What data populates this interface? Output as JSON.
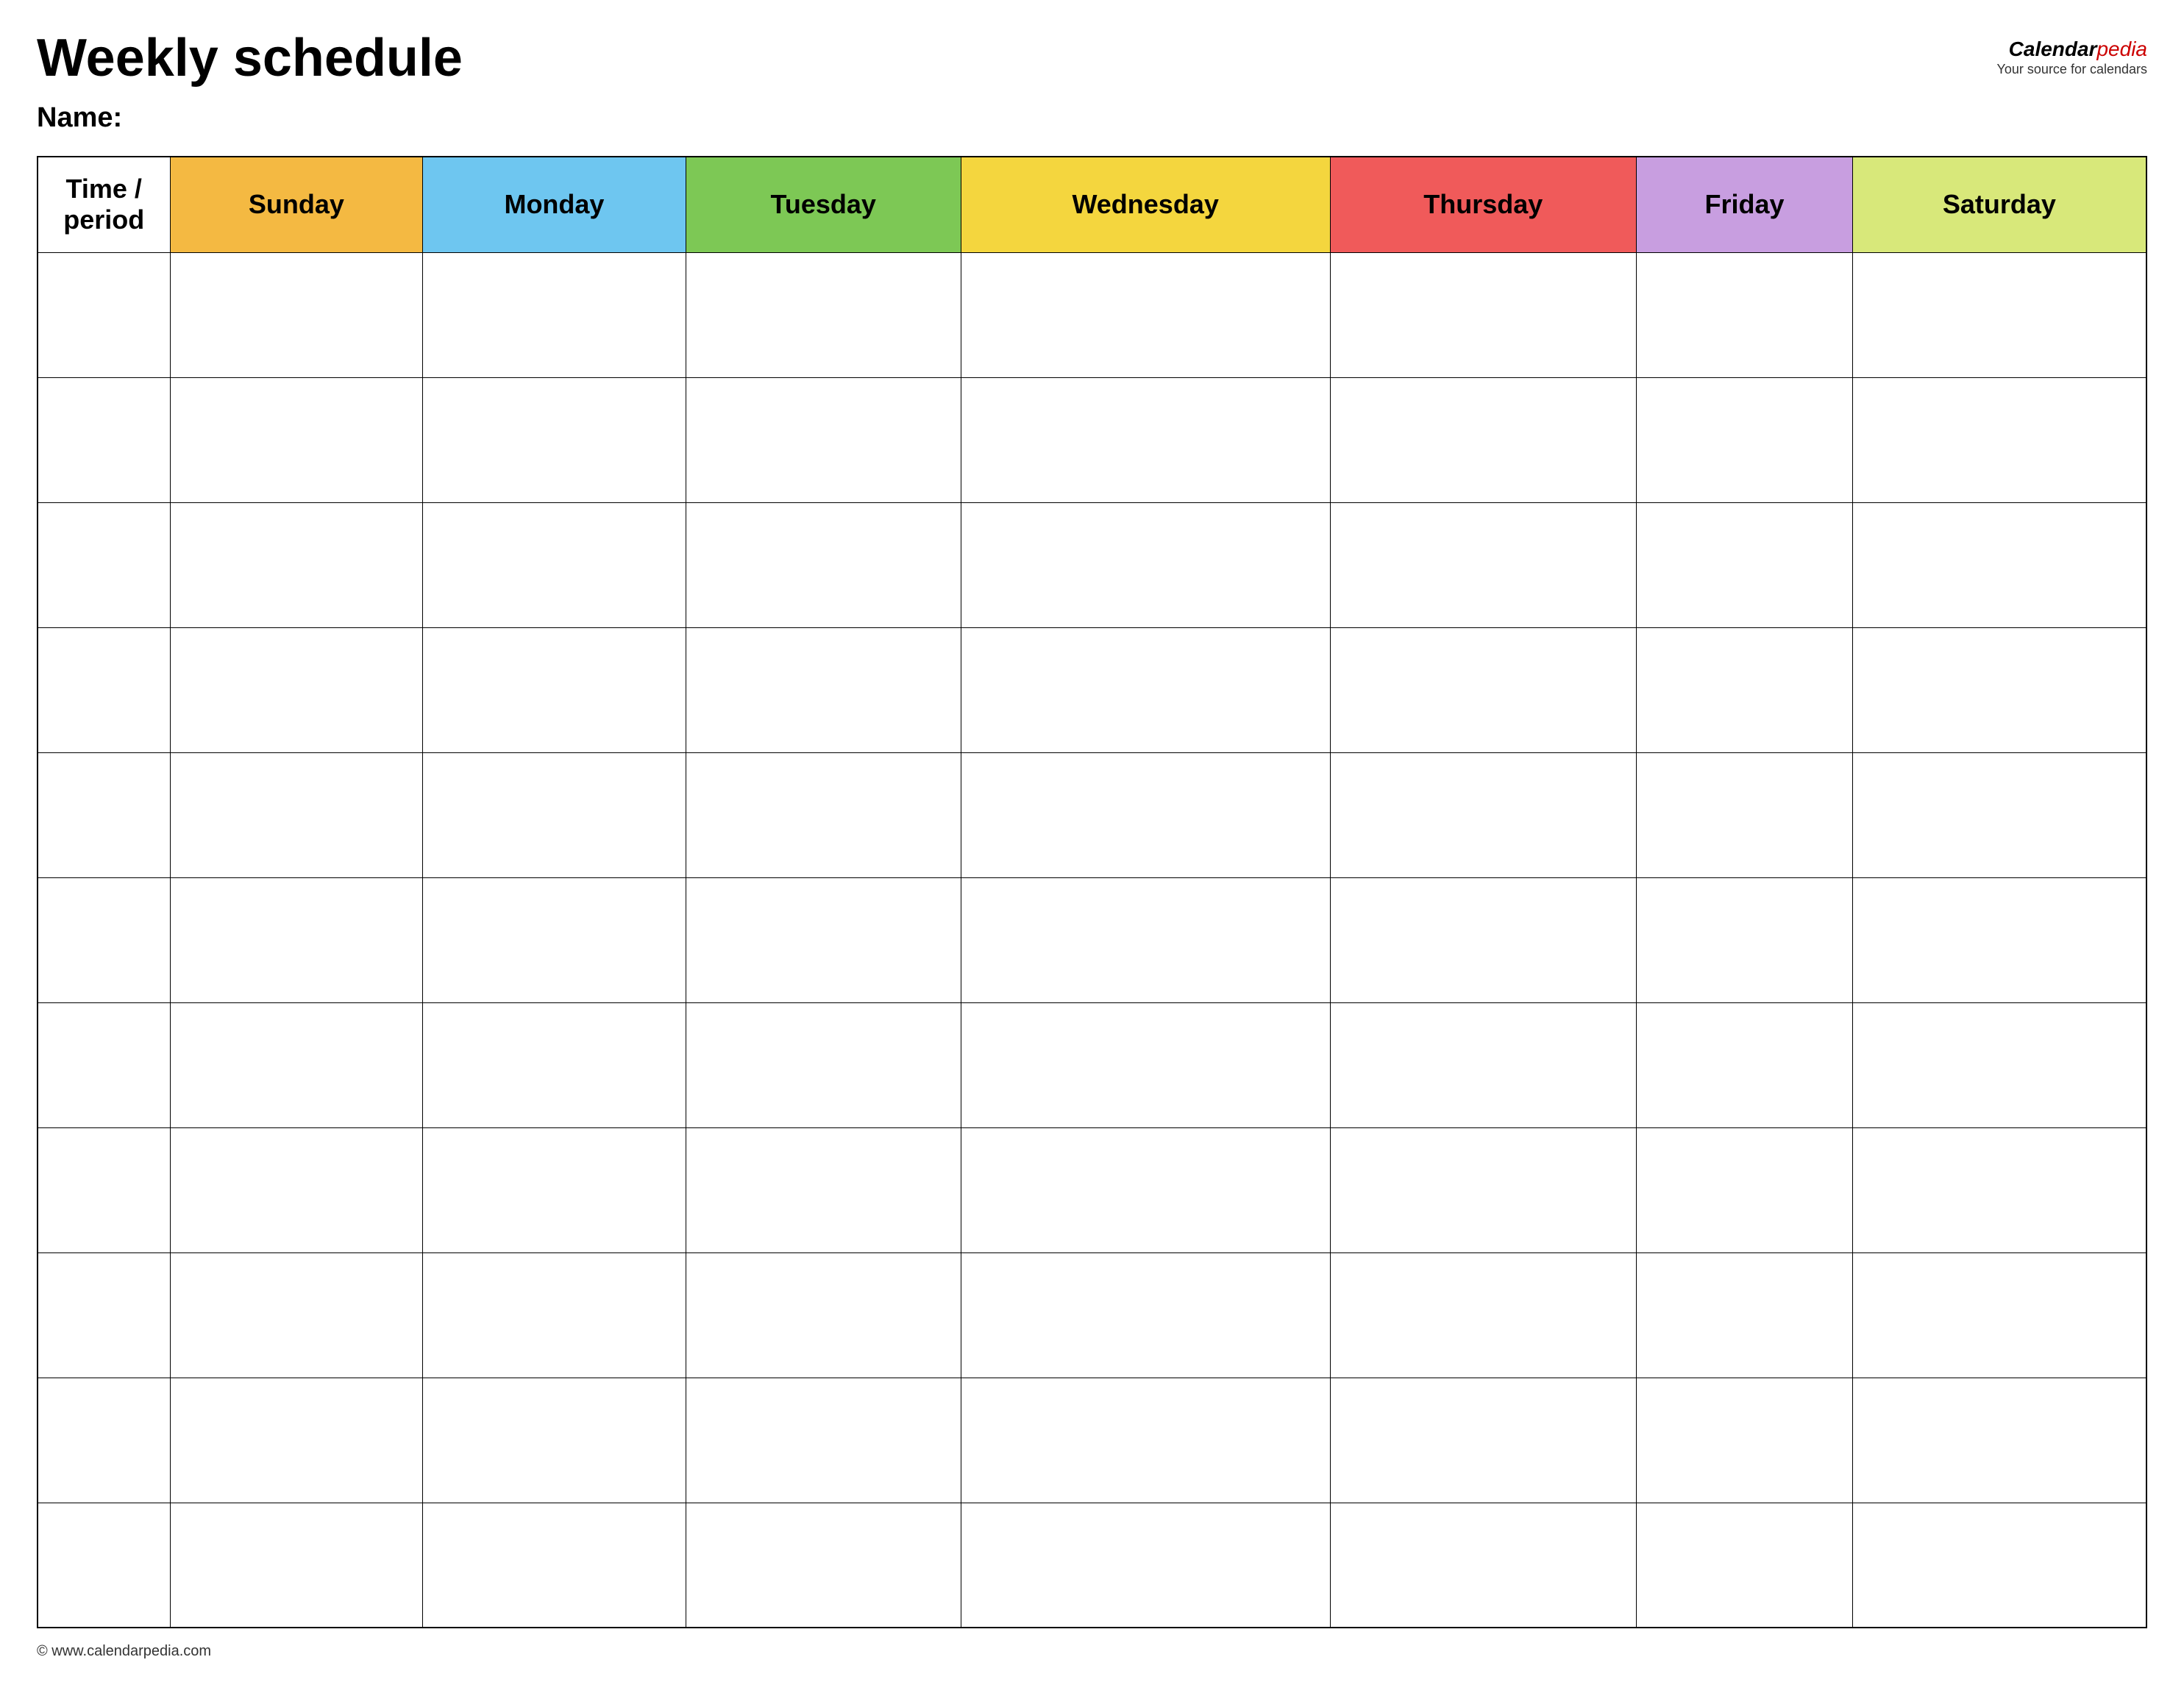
{
  "header": {
    "title": "Weekly schedule",
    "name_label": "Name:",
    "logo": {
      "brand_black": "Calendar",
      "brand_red": "pedia",
      "tagline": "Your source for calendars"
    }
  },
  "columns": {
    "time_period": "Time / period",
    "sunday": "Sunday",
    "monday": "Monday",
    "tuesday": "Tuesday",
    "wednesday": "Wednesday",
    "thursday": "Thursday",
    "friday": "Friday",
    "saturday": "Saturday"
  },
  "footer": {
    "website": "© www.calendarpedia.com"
  },
  "rows": 11
}
